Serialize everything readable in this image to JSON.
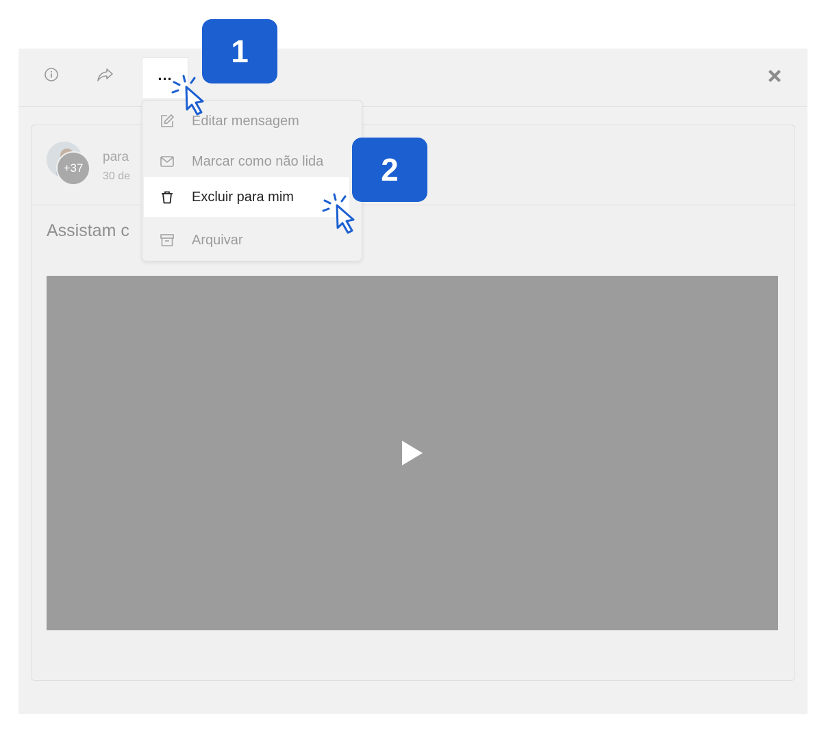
{
  "toolbar": {
    "info_icon": "info-circle-icon",
    "share_icon": "share-arrow-icon",
    "more_label": "...",
    "close_icon": "close-x-icon"
  },
  "message": {
    "avatar_count": "+37",
    "recipient_prefix": "para",
    "date_partial": "30 de",
    "subject_partial": "Assistam c"
  },
  "menu": {
    "items": [
      {
        "label": "Editar mensagem",
        "icon": "edit-icon"
      },
      {
        "label": "Marcar como não lida",
        "icon": "envelope-icon"
      },
      {
        "label": "Excluir para mim",
        "icon": "trash-icon"
      },
      {
        "label": "Arquivar",
        "icon": "archive-icon"
      }
    ]
  },
  "steps": [
    "1",
    "2"
  ],
  "colors": {
    "badge": "#1b5fd1",
    "overlay": "#f1f1f1",
    "video": "#9c9c9c"
  }
}
